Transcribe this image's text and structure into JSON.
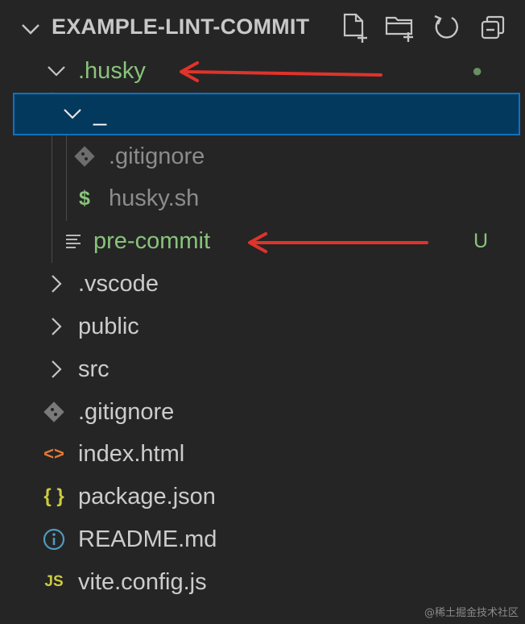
{
  "explorer": {
    "title": "EXAMPLE-LINT-COMMIT",
    "tools": [
      {
        "name": "new-file-icon"
      },
      {
        "name": "new-folder-icon"
      },
      {
        "name": "refresh-icon"
      },
      {
        "name": "collapse-all-icon"
      }
    ]
  },
  "tree": {
    "husky": {
      "label": ".husky",
      "decoration": "●",
      "color": "#89c479"
    },
    "underscore": {
      "label": "_"
    },
    "gitignore_inner": {
      "label": ".gitignore"
    },
    "husky_sh": {
      "label": "husky.sh",
      "icon_text": "$"
    },
    "pre_commit": {
      "label": "pre-commit",
      "decoration": "U",
      "color": "#89c479"
    },
    "vscode": {
      "label": ".vscode"
    },
    "public": {
      "label": "public"
    },
    "src": {
      "label": "src"
    },
    "gitignore_root": {
      "label": ".gitignore"
    },
    "index_html": {
      "label": "index.html",
      "icon_text": "<>"
    },
    "package_json": {
      "label": "package.json",
      "icon_text": "{ }"
    },
    "readme": {
      "label": "README.md",
      "icon_text": "i"
    },
    "vite_config": {
      "label": "vite.config.js",
      "icon_text": "JS"
    }
  },
  "colors": {
    "sidebar_bg": "#252526",
    "selection_bg": "#04395e",
    "selection_border": "#0e72c3",
    "git_untracked": "#89c479",
    "annotation_arrow": "#e0332a"
  },
  "watermark": "@稀土掘金技术社区"
}
